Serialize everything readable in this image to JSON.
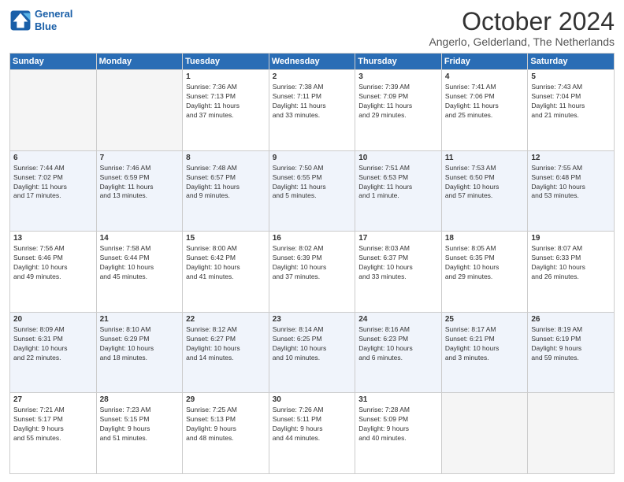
{
  "header": {
    "logo_line1": "General",
    "logo_line2": "Blue",
    "month": "October 2024",
    "location": "Angerlo, Gelderland, The Netherlands"
  },
  "weekdays": [
    "Sunday",
    "Monday",
    "Tuesday",
    "Wednesday",
    "Thursday",
    "Friday",
    "Saturday"
  ],
  "weeks": [
    [
      {
        "day": "",
        "info": ""
      },
      {
        "day": "",
        "info": ""
      },
      {
        "day": "1",
        "info": "Sunrise: 7:36 AM\nSunset: 7:13 PM\nDaylight: 11 hours\nand 37 minutes."
      },
      {
        "day": "2",
        "info": "Sunrise: 7:38 AM\nSunset: 7:11 PM\nDaylight: 11 hours\nand 33 minutes."
      },
      {
        "day": "3",
        "info": "Sunrise: 7:39 AM\nSunset: 7:09 PM\nDaylight: 11 hours\nand 29 minutes."
      },
      {
        "day": "4",
        "info": "Sunrise: 7:41 AM\nSunset: 7:06 PM\nDaylight: 11 hours\nand 25 minutes."
      },
      {
        "day": "5",
        "info": "Sunrise: 7:43 AM\nSunset: 7:04 PM\nDaylight: 11 hours\nand 21 minutes."
      }
    ],
    [
      {
        "day": "6",
        "info": "Sunrise: 7:44 AM\nSunset: 7:02 PM\nDaylight: 11 hours\nand 17 minutes."
      },
      {
        "day": "7",
        "info": "Sunrise: 7:46 AM\nSunset: 6:59 PM\nDaylight: 11 hours\nand 13 minutes."
      },
      {
        "day": "8",
        "info": "Sunrise: 7:48 AM\nSunset: 6:57 PM\nDaylight: 11 hours\nand 9 minutes."
      },
      {
        "day": "9",
        "info": "Sunrise: 7:50 AM\nSunset: 6:55 PM\nDaylight: 11 hours\nand 5 minutes."
      },
      {
        "day": "10",
        "info": "Sunrise: 7:51 AM\nSunset: 6:53 PM\nDaylight: 11 hours\nand 1 minute."
      },
      {
        "day": "11",
        "info": "Sunrise: 7:53 AM\nSunset: 6:50 PM\nDaylight: 10 hours\nand 57 minutes."
      },
      {
        "day": "12",
        "info": "Sunrise: 7:55 AM\nSunset: 6:48 PM\nDaylight: 10 hours\nand 53 minutes."
      }
    ],
    [
      {
        "day": "13",
        "info": "Sunrise: 7:56 AM\nSunset: 6:46 PM\nDaylight: 10 hours\nand 49 minutes."
      },
      {
        "day": "14",
        "info": "Sunrise: 7:58 AM\nSunset: 6:44 PM\nDaylight: 10 hours\nand 45 minutes."
      },
      {
        "day": "15",
        "info": "Sunrise: 8:00 AM\nSunset: 6:42 PM\nDaylight: 10 hours\nand 41 minutes."
      },
      {
        "day": "16",
        "info": "Sunrise: 8:02 AM\nSunset: 6:39 PM\nDaylight: 10 hours\nand 37 minutes."
      },
      {
        "day": "17",
        "info": "Sunrise: 8:03 AM\nSunset: 6:37 PM\nDaylight: 10 hours\nand 33 minutes."
      },
      {
        "day": "18",
        "info": "Sunrise: 8:05 AM\nSunset: 6:35 PM\nDaylight: 10 hours\nand 29 minutes."
      },
      {
        "day": "19",
        "info": "Sunrise: 8:07 AM\nSunset: 6:33 PM\nDaylight: 10 hours\nand 26 minutes."
      }
    ],
    [
      {
        "day": "20",
        "info": "Sunrise: 8:09 AM\nSunset: 6:31 PM\nDaylight: 10 hours\nand 22 minutes."
      },
      {
        "day": "21",
        "info": "Sunrise: 8:10 AM\nSunset: 6:29 PM\nDaylight: 10 hours\nand 18 minutes."
      },
      {
        "day": "22",
        "info": "Sunrise: 8:12 AM\nSunset: 6:27 PM\nDaylight: 10 hours\nand 14 minutes."
      },
      {
        "day": "23",
        "info": "Sunrise: 8:14 AM\nSunset: 6:25 PM\nDaylight: 10 hours\nand 10 minutes."
      },
      {
        "day": "24",
        "info": "Sunrise: 8:16 AM\nSunset: 6:23 PM\nDaylight: 10 hours\nand 6 minutes."
      },
      {
        "day": "25",
        "info": "Sunrise: 8:17 AM\nSunset: 6:21 PM\nDaylight: 10 hours\nand 3 minutes."
      },
      {
        "day": "26",
        "info": "Sunrise: 8:19 AM\nSunset: 6:19 PM\nDaylight: 9 hours\nand 59 minutes."
      }
    ],
    [
      {
        "day": "27",
        "info": "Sunrise: 7:21 AM\nSunset: 5:17 PM\nDaylight: 9 hours\nand 55 minutes."
      },
      {
        "day": "28",
        "info": "Sunrise: 7:23 AM\nSunset: 5:15 PM\nDaylight: 9 hours\nand 51 minutes."
      },
      {
        "day": "29",
        "info": "Sunrise: 7:25 AM\nSunset: 5:13 PM\nDaylight: 9 hours\nand 48 minutes."
      },
      {
        "day": "30",
        "info": "Sunrise: 7:26 AM\nSunset: 5:11 PM\nDaylight: 9 hours\nand 44 minutes."
      },
      {
        "day": "31",
        "info": "Sunrise: 7:28 AM\nSunset: 5:09 PM\nDaylight: 9 hours\nand 40 minutes."
      },
      {
        "day": "",
        "info": ""
      },
      {
        "day": "",
        "info": ""
      }
    ]
  ]
}
